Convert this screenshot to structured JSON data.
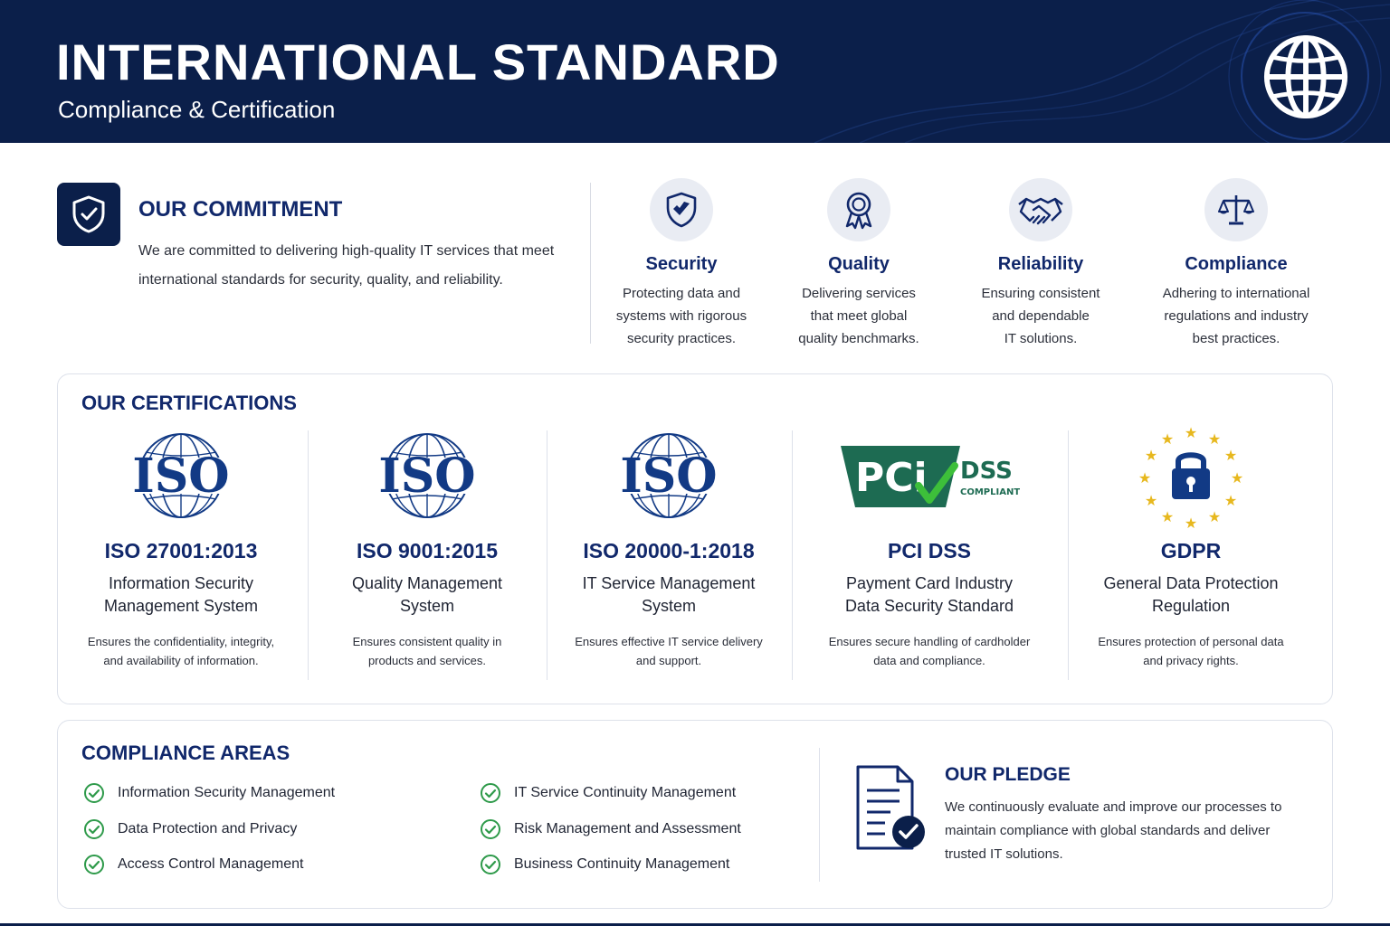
{
  "header": {
    "title": "INTERNATIONAL STANDARD",
    "subtitle": "Compliance & Certification",
    "icon": "globe-icon"
  },
  "commitment": {
    "title": "OUR COMMITMENT",
    "text": "We are committed to delivering high-quality IT services that meet international standards for security, quality, and reliability.",
    "icon": "shield-check-icon"
  },
  "values": [
    {
      "title": "Security",
      "line1": "Protecting data and",
      "line2": "systems with rigorous",
      "line3": "security practices.",
      "icon": "shield-icon"
    },
    {
      "title": "Quality",
      "line1": "Delivering services",
      "line2": "that meet global",
      "line3": "quality benchmarks.",
      "icon": "award-ribbon-icon"
    },
    {
      "title": "Reliability",
      "line1": "Ensuring consistent",
      "line2": "and dependable",
      "line3": "IT solutions.",
      "icon": "handshake-icon"
    },
    {
      "title": "Compliance",
      "line1": "Adhering to international",
      "line2": "regulations and industry",
      "line3": "best practices.",
      "icon": "scales-icon"
    }
  ],
  "certifications": {
    "title": "OUR CERTIFICATIONS",
    "iso_mark": "ISO",
    "pci_mark": "PCi",
    "dss_mark": "DSS",
    "compliant_mark": "COMPLIANT",
    "items": [
      {
        "name": "ISO 27001:2013",
        "full1": "Information Security",
        "full2": "Management System",
        "desc1": "Ensures the confidentiality, integrity,",
        "desc2": "and availability of information."
      },
      {
        "name": "ISO 9001:2015",
        "full1": "Quality Management",
        "full2": "System",
        "desc1": "Ensures consistent quality in",
        "desc2": "products and services."
      },
      {
        "name": "ISO 20000-1:2018",
        "full1": "IT Service Management",
        "full2": "System",
        "desc1": "Ensures effective IT service delivery",
        "desc2": "and support."
      },
      {
        "name": "PCI DSS",
        "full1": "Payment Card Industry",
        "full2": "Data Security Standard",
        "desc1": "Ensures secure handling of cardholder",
        "desc2": "data and compliance."
      },
      {
        "name": "GDPR",
        "full1": "General Data Protection",
        "full2": "Regulation",
        "desc1": "Ensures protection of personal data",
        "desc2": "and privacy rights."
      }
    ]
  },
  "areas": {
    "title": "COMPLIANCE AREAS",
    "left": [
      "Information Security Management",
      "Data Protection and Privacy",
      "Access Control Management"
    ],
    "right": [
      "IT Service Continuity Management",
      "Risk Management and Assessment",
      "Business Continuity Management"
    ],
    "check_color": "#2e9a4a"
  },
  "pledge": {
    "title": "OUR PLEDGE",
    "text": "We continuously evaluate and improve our processes to maintain compliance with global standards and deliver trusted IT solutions.",
    "icon": "document-check-icon"
  },
  "colors": {
    "navy": "#0b1f4a",
    "heading": "#11286b",
    "iso_blue": "#123a85",
    "pci_green": "#1d6b52",
    "eu_gold": "#e7b81e"
  }
}
